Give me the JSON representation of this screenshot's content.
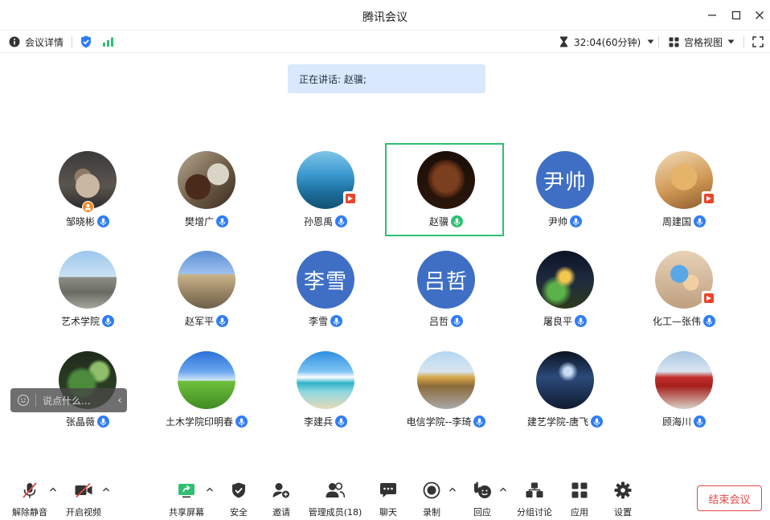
{
  "window": {
    "title": "腾讯会议"
  },
  "infobar": {
    "details_label": "会议详情",
    "timer": "32:04(60分钟)",
    "view_label": "宫格视图"
  },
  "speaker_banner": "正在讲话: 赵骥;",
  "participants": [
    {
      "name": "邹晓彬",
      "mic": "blue",
      "avatar": "photo-cat",
      "badge": "host"
    },
    {
      "name": "樊增广",
      "mic": "blue",
      "avatar": "photo-tea"
    },
    {
      "name": "孙恩禹",
      "mic": "blue",
      "avatar": "photo-ocean",
      "badge": "flag"
    },
    {
      "name": "赵骥",
      "mic": "green",
      "avatar": "photo-face",
      "active": true
    },
    {
      "name": "尹帅",
      "mic": "blue",
      "avatar": "text",
      "avatar_text": "尹帅"
    },
    {
      "name": "周建国",
      "mic": "blue",
      "avatar": "photo-carving",
      "badge": "flag"
    },
    {
      "name": "艺术学院",
      "mic": "blue",
      "avatar": "photo-building"
    },
    {
      "name": "赵军平",
      "mic": "blue",
      "avatar": "photo-temple"
    },
    {
      "name": "李雪",
      "mic": "blue",
      "avatar": "text",
      "avatar_text": "李雪"
    },
    {
      "name": "吕哲",
      "mic": "blue",
      "avatar": "text",
      "avatar_text": "吕哲"
    },
    {
      "name": "屠良平",
      "mic": "blue",
      "avatar": "photo-night"
    },
    {
      "name": "化工—张伟",
      "mic": "blue",
      "avatar": "photo-cartoon",
      "badge": "flag"
    },
    {
      "name": "张晶薇",
      "mic": "blue",
      "avatar": "photo-plants"
    },
    {
      "name": "土木学院印明春",
      "mic": "blue",
      "avatar": "photo-field"
    },
    {
      "name": "李建兵",
      "mic": "blue",
      "avatar": "photo-beach"
    },
    {
      "name": "电信学院--李琦",
      "mic": "blue",
      "avatar": "photo-street"
    },
    {
      "name": "建艺学院-唐飞",
      "mic": "blue",
      "avatar": "photo-storm"
    },
    {
      "name": "顾海川",
      "mic": "blue",
      "avatar": "photo-gate"
    }
  ],
  "chat": {
    "placeholder": "说点什么..."
  },
  "toolbar": {
    "unmute": "解除静音",
    "video": "开启视频",
    "share": "共享屏幕",
    "security": "安全",
    "invite": "邀请",
    "members": "管理成员(18)",
    "chat": "聊天",
    "record": "录制",
    "reactions": "回应",
    "breakout": "分组讨论",
    "apps": "应用",
    "settings": "设置",
    "end": "结束会议"
  },
  "colors": {
    "accent_blue": "#2f7df6",
    "speaking_green": "#2fbf71",
    "end_red": "#e04a4a",
    "text_avatar_bg": "#3e6fc4",
    "banner_bg": "#d9e8fc"
  }
}
